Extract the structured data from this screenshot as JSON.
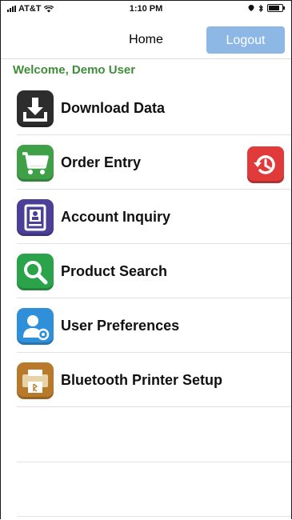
{
  "status_bar": {
    "carrier": "AT&T",
    "time": "1:10 PM"
  },
  "nav": {
    "title": "Home",
    "logout_label": "Logout"
  },
  "welcome_text": "Welcome, Demo User",
  "menu": {
    "items": [
      {
        "label": "Download Data",
        "icon": "download-icon",
        "color": "#2d2d2d"
      },
      {
        "label": "Order Entry",
        "icon": "shopping-cart-icon",
        "color": "#3fa047"
      },
      {
        "label": "Account Inquiry",
        "icon": "account-card-icon",
        "color": "#4b3f98"
      },
      {
        "label": "Product Search",
        "icon": "search-icon",
        "color": "#2aa34a"
      },
      {
        "label": "User Preferences",
        "icon": "user-settings-icon",
        "color": "#2f8fd8"
      },
      {
        "label": "Bluetooth Printer Setup",
        "icon": "printer-icon",
        "color": "#b9792a"
      }
    ]
  },
  "colors": {
    "accent_blue": "#8db8e6",
    "welcome_green": "#3f8c3a",
    "history_red": "#e03a3a"
  }
}
